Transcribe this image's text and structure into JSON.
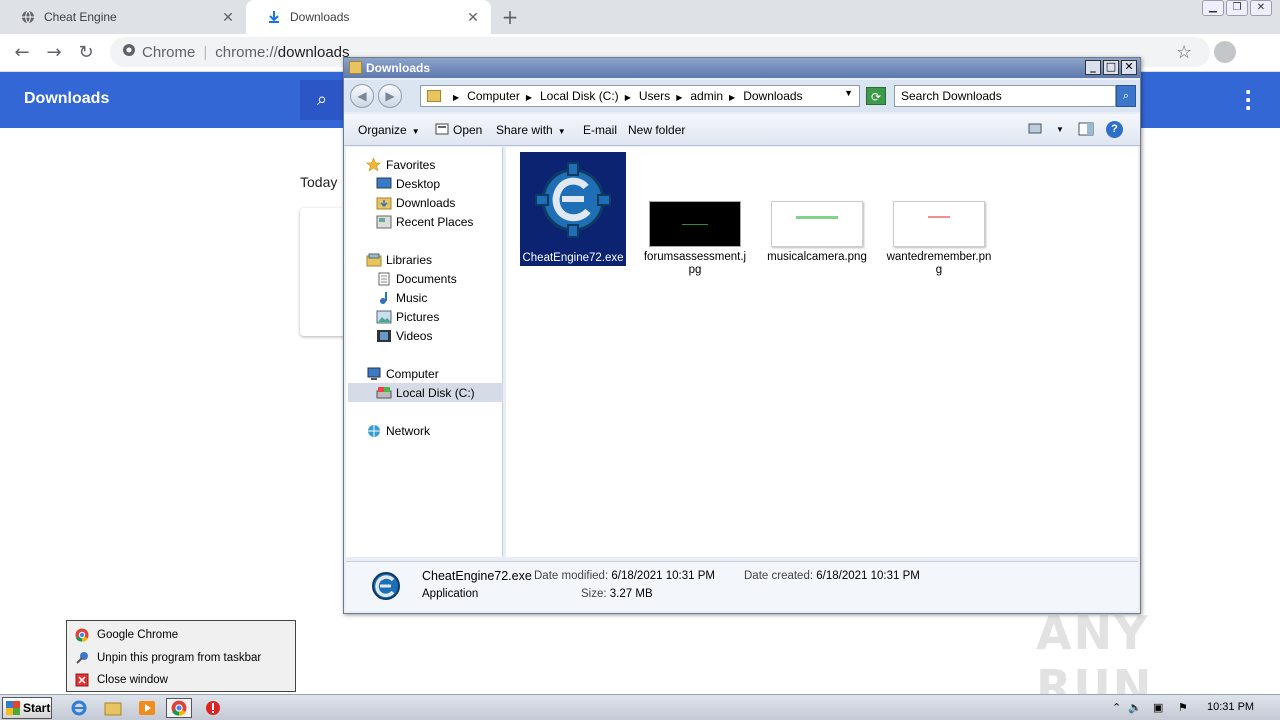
{
  "browser": {
    "tabs": [
      {
        "title": "Cheat Engine",
        "icon": "globe-icon"
      },
      {
        "title": "Downloads",
        "icon": "download-icon"
      }
    ],
    "omnibox": {
      "chip": "Chrome",
      "url_scheme": "chrome://",
      "url_path": "downloads"
    }
  },
  "downloads_page": {
    "title": "Downloads",
    "section": "Today"
  },
  "explorer": {
    "title": "Downloads",
    "breadcrumbs": [
      "Computer",
      "Local Disk (C:)",
      "Users",
      "admin",
      "Downloads"
    ],
    "search_placeholder": "Search Downloads",
    "commands": {
      "organize": "Organize",
      "open": "Open",
      "share_with": "Share with",
      "email": "E-mail",
      "new_folder": "New folder"
    },
    "nav": {
      "favorites": "Favorites",
      "desktop": "Desktop",
      "downloads": "Downloads",
      "recent_places": "Recent Places",
      "libraries": "Libraries",
      "documents": "Documents",
      "music": "Music",
      "pictures": "Pictures",
      "videos": "Videos",
      "computer": "Computer",
      "local_disk": "Local Disk (C:)",
      "network": "Network"
    },
    "files": [
      {
        "name": "CheatEngine72.exe",
        "selected": true
      },
      {
        "name": "forumsassessment.jpg",
        "selected": false
      },
      {
        "name": "musicalcamera.png",
        "selected": false
      },
      {
        "name": "wantedremember.png",
        "selected": false
      }
    ],
    "details": {
      "name": "CheatEngine72.exe",
      "type": "Application",
      "modified_label": "Date modified:",
      "modified_value": "6/18/2021 10:31 PM",
      "created_label": "Date created:",
      "created_value": "6/18/2021 10:31 PM",
      "size_label": "Size:",
      "size_value": "3.27 MB"
    }
  },
  "jumplist": {
    "items": [
      "Google Chrome",
      "Unpin this program from taskbar",
      "Close window"
    ]
  },
  "taskbar": {
    "start": "Start",
    "clock": "10:31 PM"
  },
  "watermark": "ANY RUN",
  "colors": {
    "chrome_header": "#3367d6",
    "selection": "#0b2370",
    "taskbar": "#c4cad5"
  }
}
